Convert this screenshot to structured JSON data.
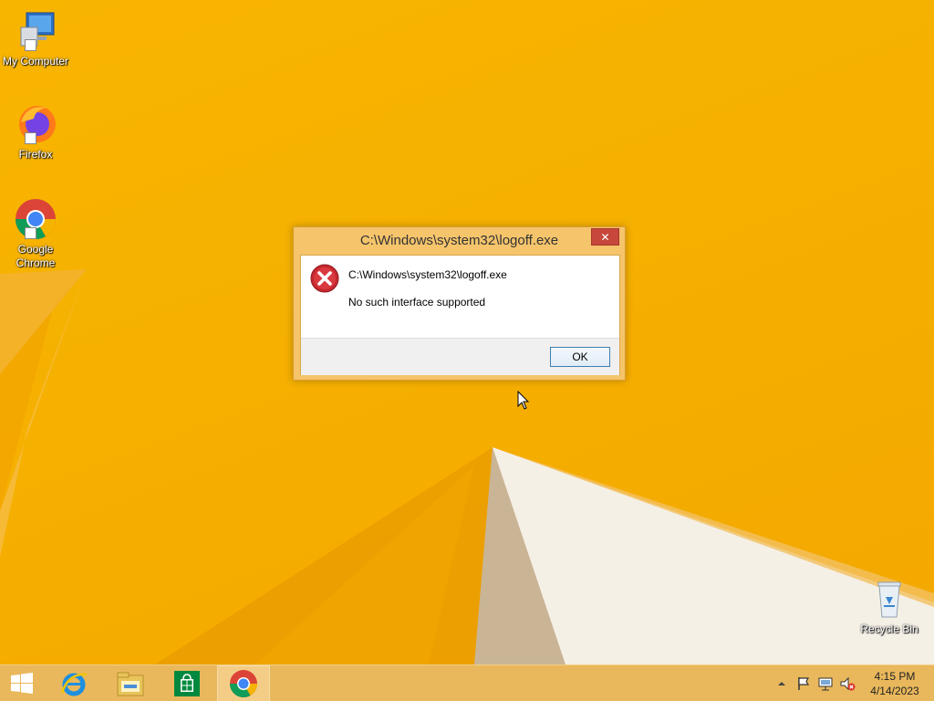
{
  "desktop": {
    "icons": [
      {
        "label": "My Computer",
        "icon": "computer-icon"
      },
      {
        "label": "Firefox",
        "icon": "firefox-icon"
      },
      {
        "label": "Google Chrome",
        "icon": "chrome-icon"
      },
      {
        "label": "Recycle Bin",
        "icon": "recycle-bin-icon"
      }
    ]
  },
  "dialog": {
    "title": "C:\\Windows\\system32\\logoff.exe",
    "close_label": "✕",
    "message_title": "C:\\Windows\\system32\\logoff.exe",
    "message": "No such interface supported",
    "ok_label": "OK",
    "icon": "error-icon"
  },
  "taskbar": {
    "buttons": [
      {
        "icon": "start-icon"
      },
      {
        "icon": "internet-explorer-icon"
      },
      {
        "icon": "file-explorer-icon"
      },
      {
        "icon": "store-icon"
      },
      {
        "icon": "chrome-icon",
        "active": true
      }
    ],
    "tray": {
      "icons": [
        "show-hidden-icons-icon",
        "action-center-flag-icon",
        "network-icon",
        "volume-muted-icon"
      ],
      "time": "4:15 PM",
      "date": "4/14/2023"
    }
  },
  "colors": {
    "wallpaper": "#f8b500",
    "dialog_frame": "#f5c46b",
    "close_button": "#c7473c",
    "taskbar": "#e9b85c"
  }
}
